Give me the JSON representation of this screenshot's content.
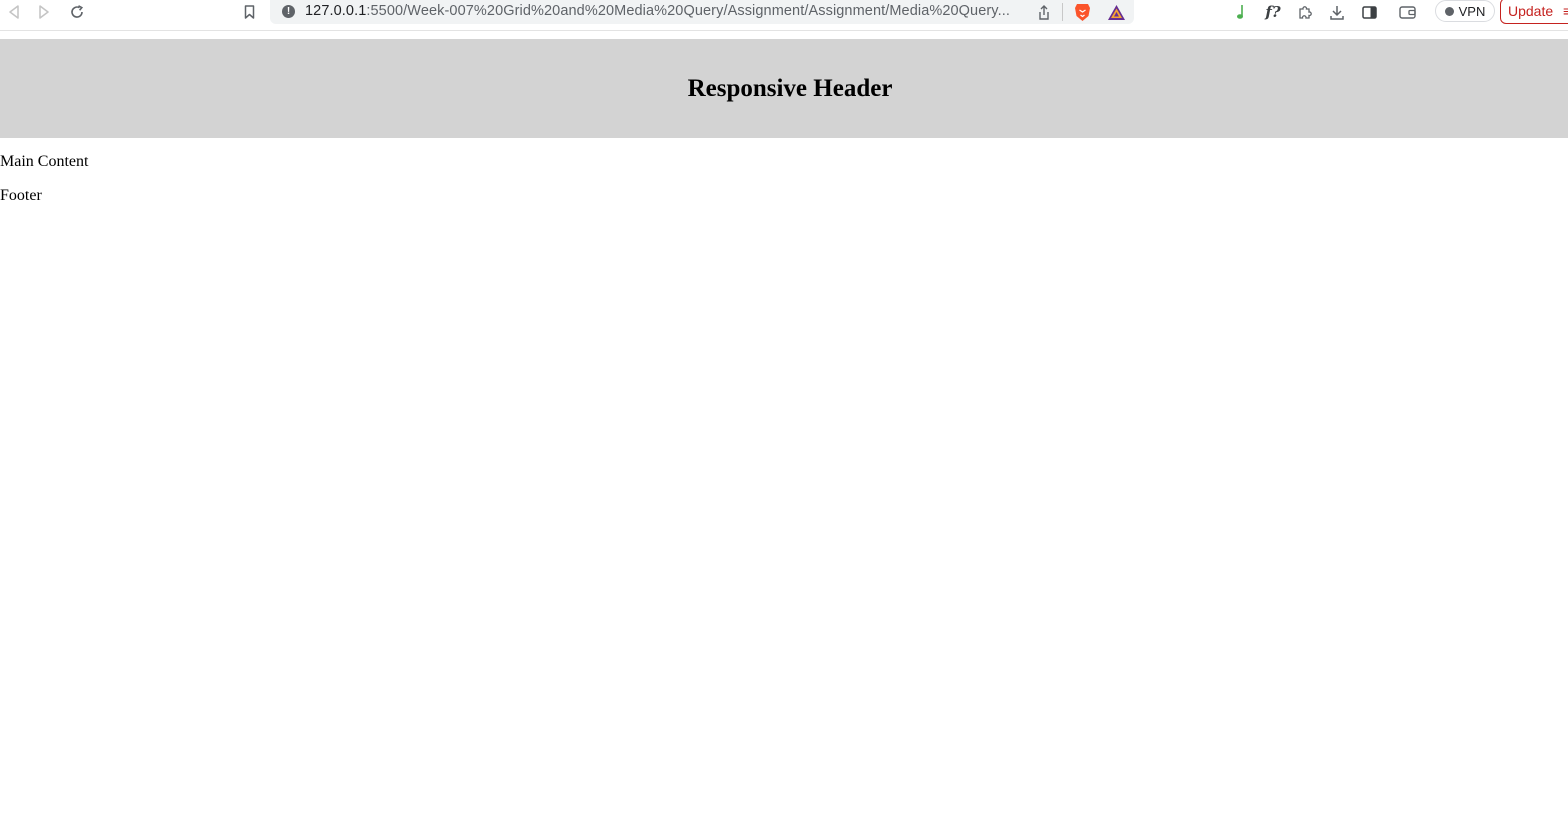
{
  "browser": {
    "url_host": "127.0.0.1",
    "url_rest": ":5500/Week-007%20Grid%20and%20Media%20Query/Assignment/Assignment/Media%20Query...",
    "vpn_label": "VPN",
    "update_label": "Update",
    "icons": {
      "back": "back-arrow-icon",
      "forward": "forward-arrow-icon",
      "reload": "reload-icon",
      "bookmark": "bookmark-icon",
      "site_info": "info-icon",
      "share": "share-icon",
      "brave": "brave-lion-icon",
      "rewards": "brave-rewards-triangle-icon",
      "music": "music-note-icon",
      "formula": "formula-icon",
      "extensions": "puzzle-piece-icon",
      "downloads": "download-icon",
      "sidebar": "sidebar-icon",
      "wallet": "wallet-icon",
      "menu": "hamburger-menu-icon"
    },
    "formula_glyph": "f?"
  },
  "page": {
    "header_title": "Responsive Header",
    "main_content": "Main Content",
    "footer": "Footer"
  },
  "colors": {
    "header_background": "#d3d3d3",
    "page_background": "#ffffff",
    "text": "#000000",
    "update_accent": "#c5221f"
  }
}
